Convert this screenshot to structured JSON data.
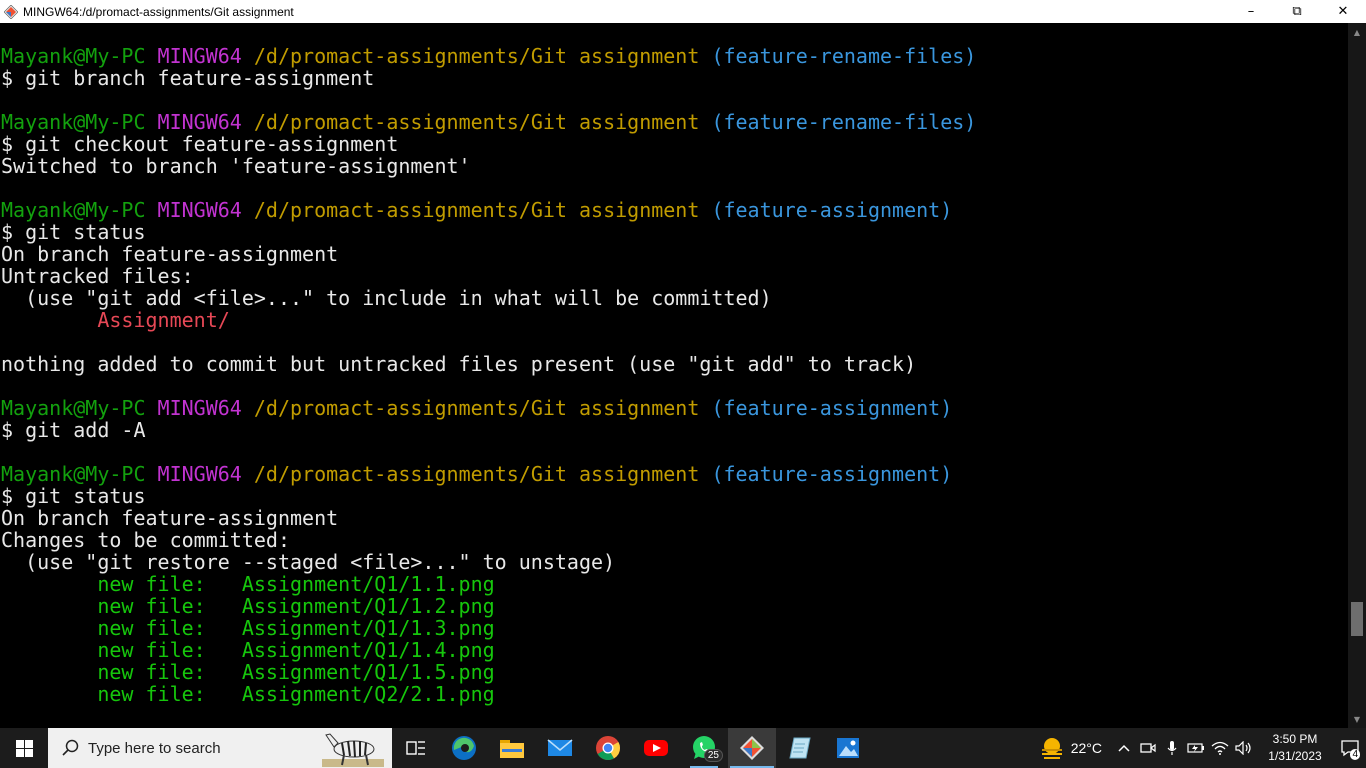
{
  "window": {
    "title": "MINGW64:/d/promact-assignments/Git assignment",
    "minimize": "–",
    "maximize": "⧉",
    "close": "✕"
  },
  "terminal": {
    "colors": {
      "user": "#13a10e",
      "host": "#c233d1",
      "path": "#c19c00",
      "branch": "#3a96dd",
      "untracked": "#e74856",
      "staged": "#16c60c"
    },
    "lines": [
      {
        "segments": [
          {
            "text": "Mayank@My-PC ",
            "color": "user"
          },
          {
            "text": "MINGW64 ",
            "color": "host"
          },
          {
            "text": "/d/promact-assignments/Git assignment ",
            "color": "path"
          },
          {
            "text": "(feature-rename-files)",
            "color": "branch"
          }
        ]
      },
      {
        "segments": [
          {
            "text": "$ git branch feature-assignment",
            "color": "white"
          }
        ]
      },
      {
        "segments": []
      },
      {
        "segments": [
          {
            "text": "Mayank@My-PC ",
            "color": "user"
          },
          {
            "text": "MINGW64 ",
            "color": "host"
          },
          {
            "text": "/d/promact-assignments/Git assignment ",
            "color": "path"
          },
          {
            "text": "(feature-rename-files)",
            "color": "branch"
          }
        ]
      },
      {
        "segments": [
          {
            "text": "$ git checkout feature-assignment",
            "color": "white"
          }
        ]
      },
      {
        "segments": [
          {
            "text": "Switched to branch 'feature-assignment'",
            "color": "white"
          }
        ]
      },
      {
        "segments": []
      },
      {
        "segments": [
          {
            "text": "Mayank@My-PC ",
            "color": "user"
          },
          {
            "text": "MINGW64 ",
            "color": "host"
          },
          {
            "text": "/d/promact-assignments/Git assignment ",
            "color": "path"
          },
          {
            "text": "(feature-assignment)",
            "color": "branch"
          }
        ]
      },
      {
        "segments": [
          {
            "text": "$ git status",
            "color": "white"
          }
        ]
      },
      {
        "segments": [
          {
            "text": "On branch feature-assignment",
            "color": "white"
          }
        ]
      },
      {
        "segments": [
          {
            "text": "Untracked files:",
            "color": "white"
          }
        ]
      },
      {
        "segments": [
          {
            "text": "  (use \"git add <file>...\" to include in what will be committed)",
            "color": "white"
          }
        ]
      },
      {
        "segments": [
          {
            "text": "        ",
            "color": "white"
          },
          {
            "text": "Assignment/",
            "color": "red"
          }
        ]
      },
      {
        "segments": []
      },
      {
        "segments": [
          {
            "text": "nothing added to commit but untracked files present (use \"git add\" to track)",
            "color": "white"
          }
        ]
      },
      {
        "segments": []
      },
      {
        "segments": [
          {
            "text": "Mayank@My-PC ",
            "color": "user"
          },
          {
            "text": "MINGW64 ",
            "color": "host"
          },
          {
            "text": "/d/promact-assignments/Git assignment ",
            "color": "path"
          },
          {
            "text": "(feature-assignment)",
            "color": "branch"
          }
        ]
      },
      {
        "segments": [
          {
            "text": "$ git add -A",
            "color": "white"
          }
        ]
      },
      {
        "segments": []
      },
      {
        "segments": [
          {
            "text": "Mayank@My-PC ",
            "color": "user"
          },
          {
            "text": "MINGW64 ",
            "color": "host"
          },
          {
            "text": "/d/promact-assignments/Git assignment ",
            "color": "path"
          },
          {
            "text": "(feature-assignment)",
            "color": "branch"
          }
        ]
      },
      {
        "segments": [
          {
            "text": "$ git status",
            "color": "white"
          }
        ]
      },
      {
        "segments": [
          {
            "text": "On branch feature-assignment",
            "color": "white"
          }
        ]
      },
      {
        "segments": [
          {
            "text": "Changes to be committed:",
            "color": "white"
          }
        ]
      },
      {
        "segments": [
          {
            "text": "  (use \"git restore --staged <file>...\" to unstage)",
            "color": "white"
          }
        ]
      },
      {
        "segments": [
          {
            "text": "        ",
            "color": "white"
          },
          {
            "text": "new file:   Assignment/Q1/1.1.png",
            "color": "green"
          }
        ]
      },
      {
        "segments": [
          {
            "text": "        ",
            "color": "white"
          },
          {
            "text": "new file:   Assignment/Q1/1.2.png",
            "color": "green"
          }
        ]
      },
      {
        "segments": [
          {
            "text": "        ",
            "color": "white"
          },
          {
            "text": "new file:   Assignment/Q1/1.3.png",
            "color": "green"
          }
        ]
      },
      {
        "segments": [
          {
            "text": "        ",
            "color": "white"
          },
          {
            "text": "new file:   Assignment/Q1/1.4.png",
            "color": "green"
          }
        ]
      },
      {
        "segments": [
          {
            "text": "        ",
            "color": "white"
          },
          {
            "text": "new file:   Assignment/Q1/1.5.png",
            "color": "green"
          }
        ]
      },
      {
        "segments": [
          {
            "text": "        ",
            "color": "white"
          },
          {
            "text": "new file:   Assignment/Q2/2.1.png",
            "color": "green"
          }
        ]
      }
    ]
  },
  "taskbar": {
    "search_placeholder": "Type here to search",
    "apps": [
      {
        "name": "task-view-icon"
      },
      {
        "name": "edge-icon"
      },
      {
        "name": "file-explorer-icon"
      },
      {
        "name": "mail-icon"
      },
      {
        "name": "chrome-icon"
      },
      {
        "name": "youtube-icon"
      },
      {
        "name": "whatsapp-icon",
        "badge": "25"
      },
      {
        "name": "git-bash-icon"
      },
      {
        "name": "notepad-icon"
      },
      {
        "name": "photos-icon"
      }
    ],
    "weather_temp": "22°C",
    "clock_time": "3:50 PM",
    "clock_date": "1/31/2023",
    "notification_count": "4"
  }
}
